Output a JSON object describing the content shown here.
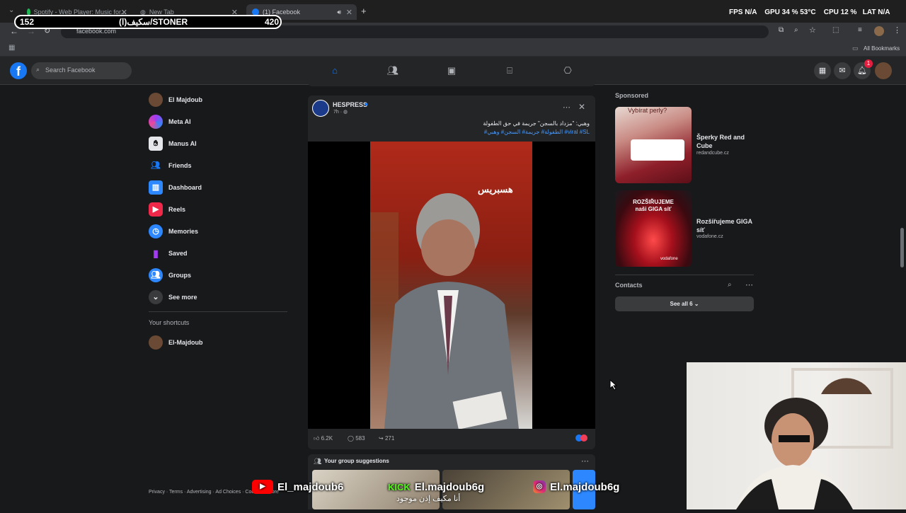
{
  "browser": {
    "tabs": [
      {
        "label": "Spotify - Web Player: Music for..."
      },
      {
        "label": "New Tab"
      },
      {
        "label": "(1) Facebook"
      }
    ],
    "url": "facebook.com",
    "bookmarks_label": "All Bookmarks",
    "hud": {
      "fps_label": "FPS",
      "fps_value": "N/A",
      "gpu_label": "GPU",
      "gpu_value": "34 % 53°C",
      "cpu_label": "CPU",
      "cpu_value": "12 %",
      "lat_label": "LAT",
      "lat_value": "N/A"
    }
  },
  "stream_pill": {
    "left": "152",
    "title": "سكيف(ا)/STONER",
    "right": "420"
  },
  "header": {
    "search_placeholder": "Search Facebook",
    "notification_count": "1"
  },
  "sidebar": {
    "items": [
      {
        "label": "El Majdoub"
      },
      {
        "label": "Meta AI"
      },
      {
        "label": "Manus AI"
      },
      {
        "label": "Friends"
      },
      {
        "label": "Dashboard"
      },
      {
        "label": "Reels"
      },
      {
        "label": "Memories"
      },
      {
        "label": "Saved"
      },
      {
        "label": "Groups"
      },
      {
        "label": "See more"
      }
    ],
    "shortcuts_title": "Your shortcuts",
    "shortcuts": [
      {
        "label": "El-Majdoub"
      }
    ],
    "footer": "Privacy · Terms · Advertising · Ad Choices · Cookies · More"
  },
  "post": {
    "author": "HESPRESS",
    "time": "7h ·",
    "text_line1": "وهبي: \"مزداد بالسجن\" جريمة في حق الطفولة",
    "text_line2": "viral #SL# الطفولة# جريمة# السجن# وهبي#",
    "video_watermark": "هسبريس",
    "likes": "6.2K",
    "comments": "583",
    "shares": "271"
  },
  "group_suggestions": {
    "title": "Your group suggestions"
  },
  "right_panel": {
    "sponsored_title": "Sponsored",
    "ads": [
      {
        "title": "Šperky Red and Cube",
        "domain": "redandcube.cz",
        "image_text": "Vybírat perly?"
      },
      {
        "title": "Rozšiřujeme GIGA síť",
        "domain": "vodafone.cz",
        "image_text": "ROZŠIŘUJEME naši GIGA síť",
        "image_brand": "vodafone"
      }
    ],
    "contacts_title": "Contacts",
    "see_all": "See all 6"
  },
  "overlay": {
    "youtube": "El_majdoub6",
    "kick": "El.majdoub6g",
    "kick_brand": "KICK",
    "instagram": "El.majdoub6g",
    "caption_ar": "أنا مكيف إذن موجود"
  },
  "colors": {
    "fb_blue": "#1877f2",
    "bg": "#18191a",
    "card": "#242526"
  }
}
